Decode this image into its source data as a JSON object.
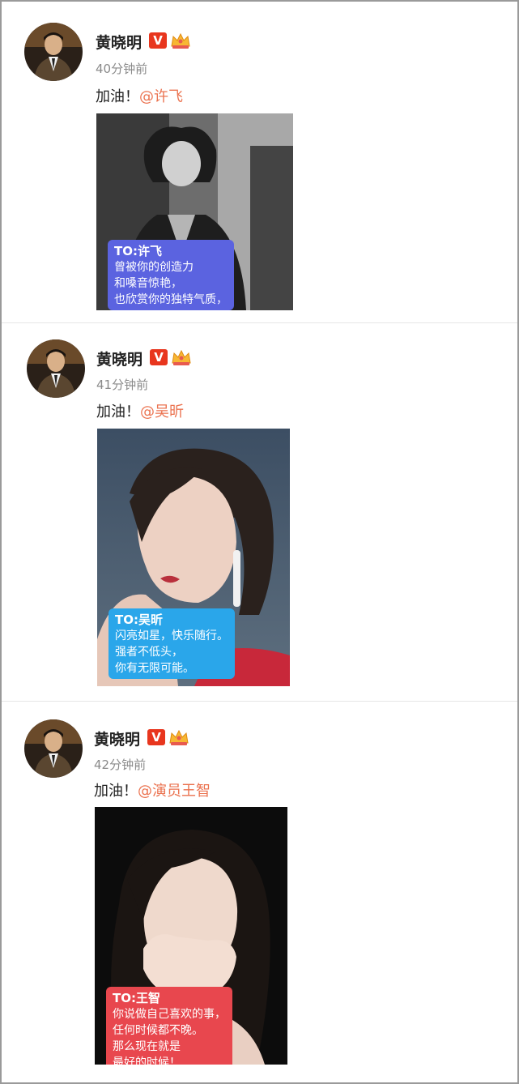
{
  "posts": [
    {
      "author": "黄晓明",
      "verified_icon": "verified-v-icon",
      "badge_icon": "crown-badge-icon",
      "time": "40分钟前",
      "text_prefix": "加油！",
      "mention": "@许飞",
      "card": {
        "color": "#5b63e0",
        "lines": [
          "TO:许飞",
          "曾被你的创造力",
          "和嗓音惊艳，",
          "也欣赏你的独特气质，"
        ]
      }
    },
    {
      "author": "黄晓明",
      "verified_icon": "verified-v-icon",
      "badge_icon": "crown-badge-icon",
      "time": "41分钟前",
      "text_prefix": "加油！",
      "mention": "@吴昕",
      "card": {
        "color": "#2aa6ea",
        "lines": [
          "TO:吴昕",
          "闪亮如星，快乐随行。",
          "强者不低头，",
          "你有无限可能。"
        ]
      }
    },
    {
      "author": "黄晓明",
      "verified_icon": "verified-v-icon",
      "badge_icon": "crown-badge-icon",
      "time": "42分钟前",
      "text_prefix": "加油！",
      "mention": "@演员王智",
      "card": {
        "color": "#e8474e",
        "lines": [
          "TO:王智",
          "你说做自己喜欢的事，",
          "任何时候都不晚。",
          "那么现在就是",
          "最好的时候！"
        ]
      }
    }
  ],
  "colors": {
    "mention": "#eb7350",
    "verified_v": "#e8361e",
    "time": "#8a8a8a"
  }
}
